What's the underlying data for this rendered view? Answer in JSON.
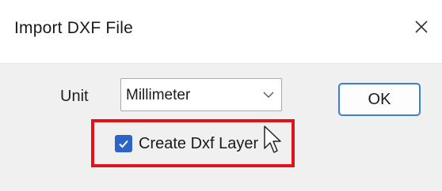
{
  "dialog": {
    "title": "Import DXF File",
    "close_icon": "close-icon"
  },
  "form": {
    "unit_label": "Unit",
    "unit_value": "Millimeter",
    "unit_dropdown_icon": "chevron-down-icon",
    "checkbox_label": "Create Dxf Layer",
    "checkbox_checked": true,
    "ok_label": "OK"
  },
  "annotation": {
    "highlight_color": "#e0131d"
  },
  "colors": {
    "accent": "#2b63c6",
    "button_border": "#3b7fd1"
  }
}
